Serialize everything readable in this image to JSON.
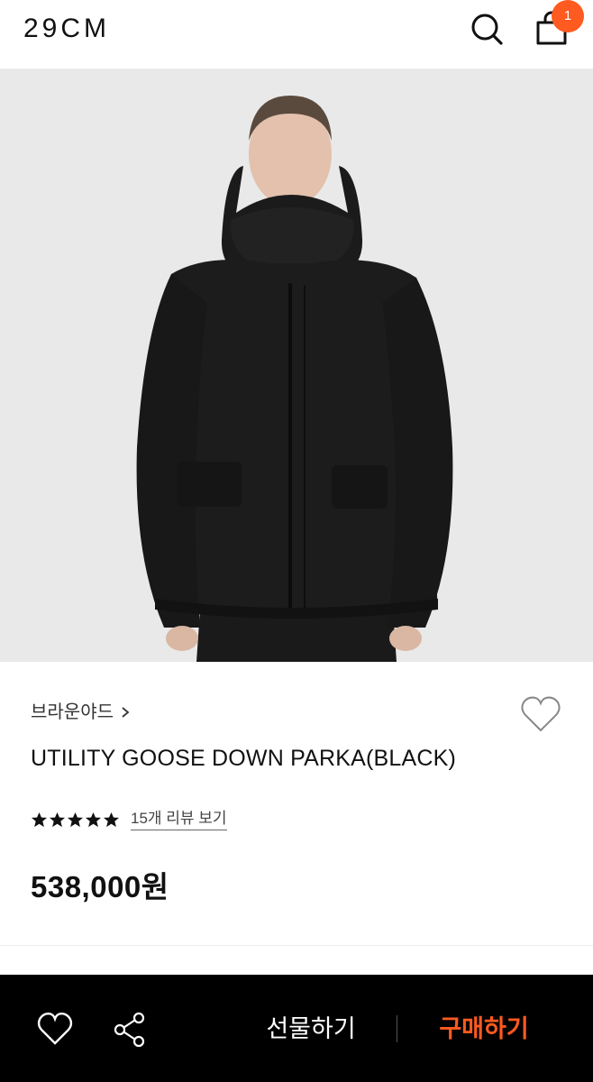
{
  "header": {
    "logo": "29CM",
    "cart_count": "1"
  },
  "hero": {
    "image_alt": "black hooded down parka"
  },
  "product": {
    "brand": "브라운야드",
    "name": "UTILITY GOOSE DOWN PARKA(BLACK)",
    "rating_stars": 5,
    "review_link": "15개 리뷰 보기",
    "price": "538,000원"
  },
  "bottom_bar": {
    "gift_label": "선물하기",
    "buy_label": "구매하기"
  },
  "colors": {
    "accent": "#ff5a1f",
    "bottom_bar_bg": "#000000",
    "hero_bg": "#e9e9e9"
  },
  "icons": [
    "search-icon",
    "shopping-bag-icon",
    "chevron-right-icon",
    "heart-outline-icon",
    "star-icon",
    "share-icon"
  ]
}
